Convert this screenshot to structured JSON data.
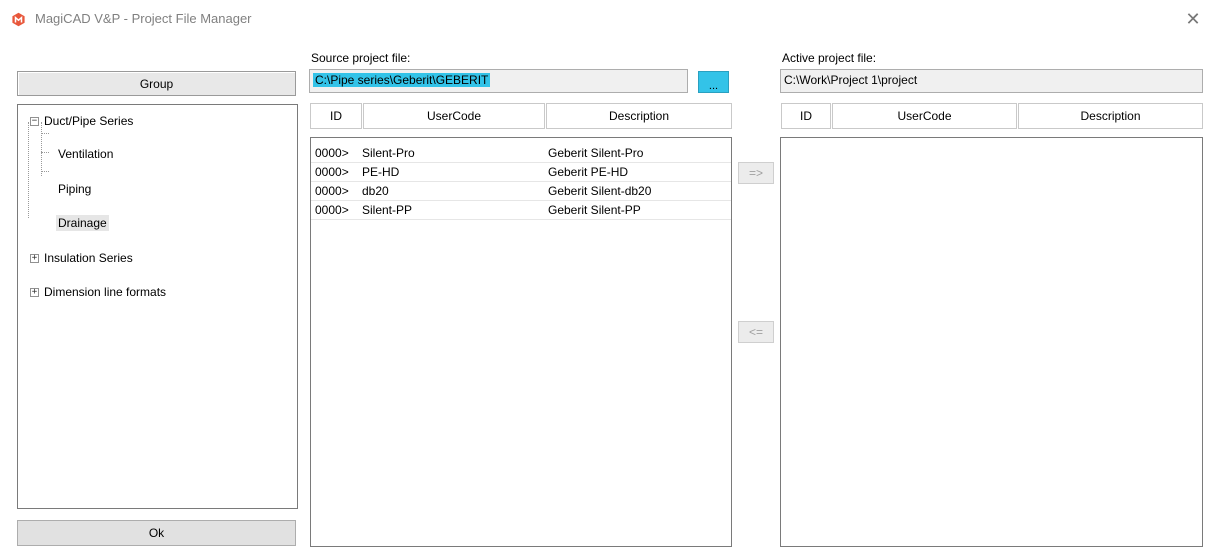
{
  "window": {
    "title": "MagiCAD V&P - Project File Manager",
    "close_glyph": "✕"
  },
  "left": {
    "group_label": "Group",
    "ok_label": "Ok",
    "tree": [
      {
        "label": "Duct/Pipe Series",
        "expander": "−"
      },
      {
        "label": "Ventilation"
      },
      {
        "label": "Piping"
      },
      {
        "label": "Drainage"
      },
      {
        "label": "Insulation Series",
        "expander": "+"
      },
      {
        "label": "Dimension line formats",
        "expander": "+"
      }
    ]
  },
  "source": {
    "label": "Source project file:",
    "path": "C:\\Pipe series\\Geberit\\GEBERIT",
    "browse_label": "...",
    "columns": {
      "id": "ID",
      "usercode": "UserCode",
      "description": "Description"
    },
    "rows": [
      {
        "id": "0000>",
        "usercode": "Silent-Pro",
        "description": "Geberit Silent-Pro"
      },
      {
        "id": "0000>",
        "usercode": "PE-HD",
        "description": "Geberit PE-HD"
      },
      {
        "id": "0000>",
        "usercode": "db20",
        "description": "Geberit Silent-db20"
      },
      {
        "id": "0000>",
        "usercode": "Silent-PP",
        "description": "Geberit Silent-PP"
      }
    ]
  },
  "transfer": {
    "copy_right_label": "=>",
    "copy_left_label": "<="
  },
  "active": {
    "label": "Active project file:",
    "path": "C:\\Work\\Project 1\\project",
    "columns": {
      "id": "ID",
      "usercode": "UserCode",
      "description": "Description"
    }
  },
  "colors": {
    "selection": "#33c3e8",
    "button_face": "#e1e1e1",
    "border": "#7a7a7a"
  },
  "icons": {
    "app": "magicad-logo-icon",
    "close": "close-icon"
  }
}
